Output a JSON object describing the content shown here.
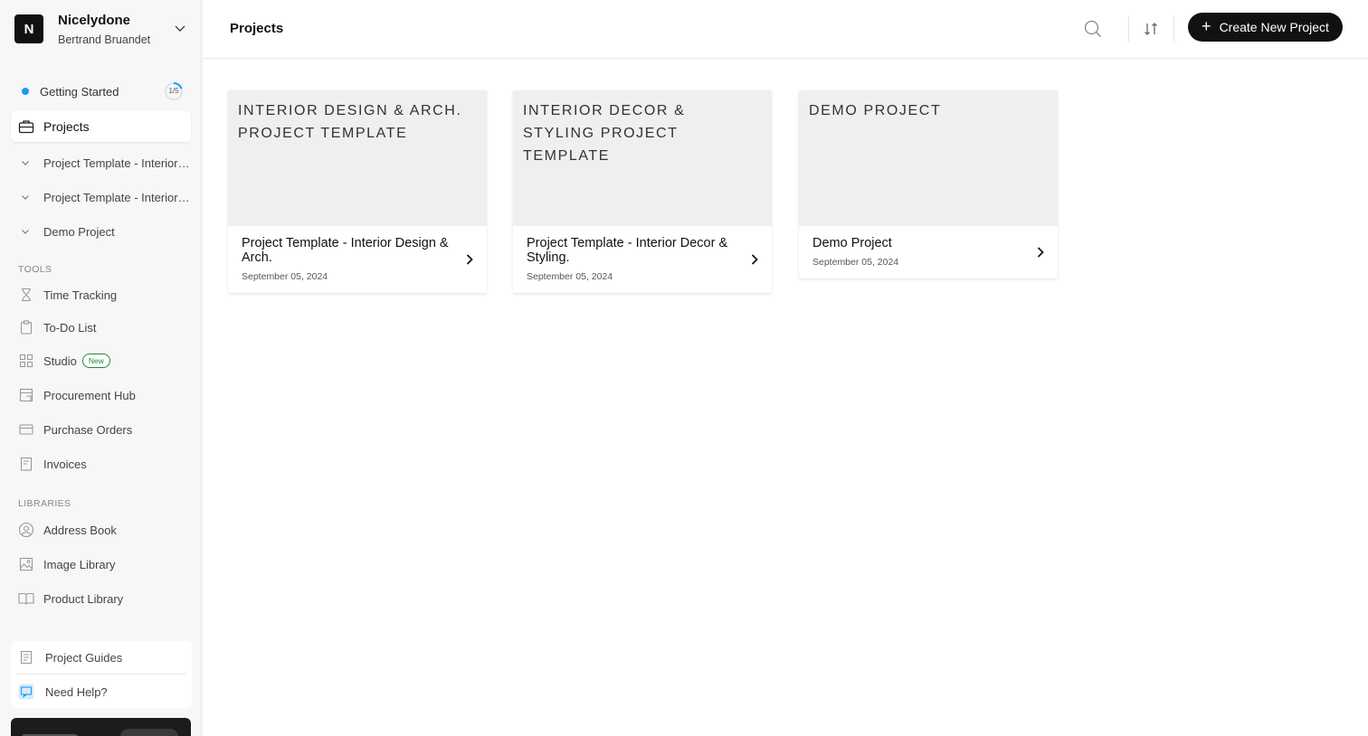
{
  "workspace": {
    "logo_letter": "N",
    "name": "Nicelydone",
    "user": "Bertrand Bruandet"
  },
  "sidebar": {
    "getting_started": {
      "label": "Getting Started",
      "progress": "1/5",
      "progress_fraction": 0.2
    },
    "projects_label": "Projects",
    "project_items": [
      {
        "label": "Project Template - Interior Design & Arch."
      },
      {
        "label": "Project Template - Interior Decor & Styling."
      },
      {
        "label": "Demo Project"
      }
    ],
    "tools_heading": "TOOLS",
    "tools": [
      {
        "label": "Time Tracking",
        "icon": "hourglass-icon"
      },
      {
        "label": "To-Do List",
        "icon": "clipboard-icon"
      },
      {
        "label": "Studio",
        "icon": "grid-icon",
        "badge": "New"
      },
      {
        "label": "Procurement Hub",
        "icon": "procurement-icon"
      },
      {
        "label": "Purchase Orders",
        "icon": "card-icon"
      },
      {
        "label": "Invoices",
        "icon": "receipt-icon"
      }
    ],
    "libraries_heading": "LIBRARIES",
    "libraries": [
      {
        "label": "Address Book",
        "icon": "user-circle-icon"
      },
      {
        "label": "Image Library",
        "icon": "image-icon"
      },
      {
        "label": "Product Library",
        "icon": "book-icon"
      }
    ],
    "footer": {
      "guides_label": "Project Guides",
      "help_label": "Need Help?"
    }
  },
  "header": {
    "title": "Projects",
    "create_label": "Create New Project"
  },
  "projects": [
    {
      "cover": "Interior Design & Arch. Project Template",
      "title": "Project Template - Interior Design & Arch.",
      "date": "September 05, 2024"
    },
    {
      "cover": "Interior Decor & Styling Project Template",
      "title": "Project Template - Interior Decor & Styling.",
      "date": "September 05, 2024"
    },
    {
      "cover": "Demo Project",
      "title": "Demo Project",
      "date": "September 05, 2024"
    }
  ],
  "colors": {
    "accent": "#1d9bf0",
    "badge_green": "#1f8a3b",
    "primary_button": "#111111"
  }
}
